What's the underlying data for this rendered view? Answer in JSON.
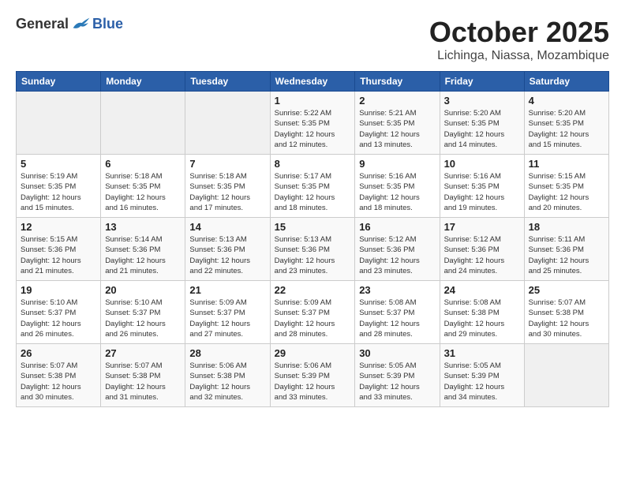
{
  "header": {
    "logo_general": "General",
    "logo_blue": "Blue",
    "month": "October 2025",
    "location": "Lichinga, Niassa, Mozambique"
  },
  "weekdays": [
    "Sunday",
    "Monday",
    "Tuesday",
    "Wednesday",
    "Thursday",
    "Friday",
    "Saturday"
  ],
  "weeks": [
    [
      {
        "day": "",
        "info": ""
      },
      {
        "day": "",
        "info": ""
      },
      {
        "day": "",
        "info": ""
      },
      {
        "day": "1",
        "info": "Sunrise: 5:22 AM\nSunset: 5:35 PM\nDaylight: 12 hours\nand 12 minutes."
      },
      {
        "day": "2",
        "info": "Sunrise: 5:21 AM\nSunset: 5:35 PM\nDaylight: 12 hours\nand 13 minutes."
      },
      {
        "day": "3",
        "info": "Sunrise: 5:20 AM\nSunset: 5:35 PM\nDaylight: 12 hours\nand 14 minutes."
      },
      {
        "day": "4",
        "info": "Sunrise: 5:20 AM\nSunset: 5:35 PM\nDaylight: 12 hours\nand 15 minutes."
      }
    ],
    [
      {
        "day": "5",
        "info": "Sunrise: 5:19 AM\nSunset: 5:35 PM\nDaylight: 12 hours\nand 15 minutes."
      },
      {
        "day": "6",
        "info": "Sunrise: 5:18 AM\nSunset: 5:35 PM\nDaylight: 12 hours\nand 16 minutes."
      },
      {
        "day": "7",
        "info": "Sunrise: 5:18 AM\nSunset: 5:35 PM\nDaylight: 12 hours\nand 17 minutes."
      },
      {
        "day": "8",
        "info": "Sunrise: 5:17 AM\nSunset: 5:35 PM\nDaylight: 12 hours\nand 18 minutes."
      },
      {
        "day": "9",
        "info": "Sunrise: 5:16 AM\nSunset: 5:35 PM\nDaylight: 12 hours\nand 18 minutes."
      },
      {
        "day": "10",
        "info": "Sunrise: 5:16 AM\nSunset: 5:35 PM\nDaylight: 12 hours\nand 19 minutes."
      },
      {
        "day": "11",
        "info": "Sunrise: 5:15 AM\nSunset: 5:35 PM\nDaylight: 12 hours\nand 20 minutes."
      }
    ],
    [
      {
        "day": "12",
        "info": "Sunrise: 5:15 AM\nSunset: 5:36 PM\nDaylight: 12 hours\nand 21 minutes."
      },
      {
        "day": "13",
        "info": "Sunrise: 5:14 AM\nSunset: 5:36 PM\nDaylight: 12 hours\nand 21 minutes."
      },
      {
        "day": "14",
        "info": "Sunrise: 5:13 AM\nSunset: 5:36 PM\nDaylight: 12 hours\nand 22 minutes."
      },
      {
        "day": "15",
        "info": "Sunrise: 5:13 AM\nSunset: 5:36 PM\nDaylight: 12 hours\nand 23 minutes."
      },
      {
        "day": "16",
        "info": "Sunrise: 5:12 AM\nSunset: 5:36 PM\nDaylight: 12 hours\nand 23 minutes."
      },
      {
        "day": "17",
        "info": "Sunrise: 5:12 AM\nSunset: 5:36 PM\nDaylight: 12 hours\nand 24 minutes."
      },
      {
        "day": "18",
        "info": "Sunrise: 5:11 AM\nSunset: 5:36 PM\nDaylight: 12 hours\nand 25 minutes."
      }
    ],
    [
      {
        "day": "19",
        "info": "Sunrise: 5:10 AM\nSunset: 5:37 PM\nDaylight: 12 hours\nand 26 minutes."
      },
      {
        "day": "20",
        "info": "Sunrise: 5:10 AM\nSunset: 5:37 PM\nDaylight: 12 hours\nand 26 minutes."
      },
      {
        "day": "21",
        "info": "Sunrise: 5:09 AM\nSunset: 5:37 PM\nDaylight: 12 hours\nand 27 minutes."
      },
      {
        "day": "22",
        "info": "Sunrise: 5:09 AM\nSunset: 5:37 PM\nDaylight: 12 hours\nand 28 minutes."
      },
      {
        "day": "23",
        "info": "Sunrise: 5:08 AM\nSunset: 5:37 PM\nDaylight: 12 hours\nand 28 minutes."
      },
      {
        "day": "24",
        "info": "Sunrise: 5:08 AM\nSunset: 5:38 PM\nDaylight: 12 hours\nand 29 minutes."
      },
      {
        "day": "25",
        "info": "Sunrise: 5:07 AM\nSunset: 5:38 PM\nDaylight: 12 hours\nand 30 minutes."
      }
    ],
    [
      {
        "day": "26",
        "info": "Sunrise: 5:07 AM\nSunset: 5:38 PM\nDaylight: 12 hours\nand 30 minutes."
      },
      {
        "day": "27",
        "info": "Sunrise: 5:07 AM\nSunset: 5:38 PM\nDaylight: 12 hours\nand 31 minutes."
      },
      {
        "day": "28",
        "info": "Sunrise: 5:06 AM\nSunset: 5:38 PM\nDaylight: 12 hours\nand 32 minutes."
      },
      {
        "day": "29",
        "info": "Sunrise: 5:06 AM\nSunset: 5:39 PM\nDaylight: 12 hours\nand 33 minutes."
      },
      {
        "day": "30",
        "info": "Sunrise: 5:05 AM\nSunset: 5:39 PM\nDaylight: 12 hours\nand 33 minutes."
      },
      {
        "day": "31",
        "info": "Sunrise: 5:05 AM\nSunset: 5:39 PM\nDaylight: 12 hours\nand 34 minutes."
      },
      {
        "day": "",
        "info": ""
      }
    ]
  ]
}
